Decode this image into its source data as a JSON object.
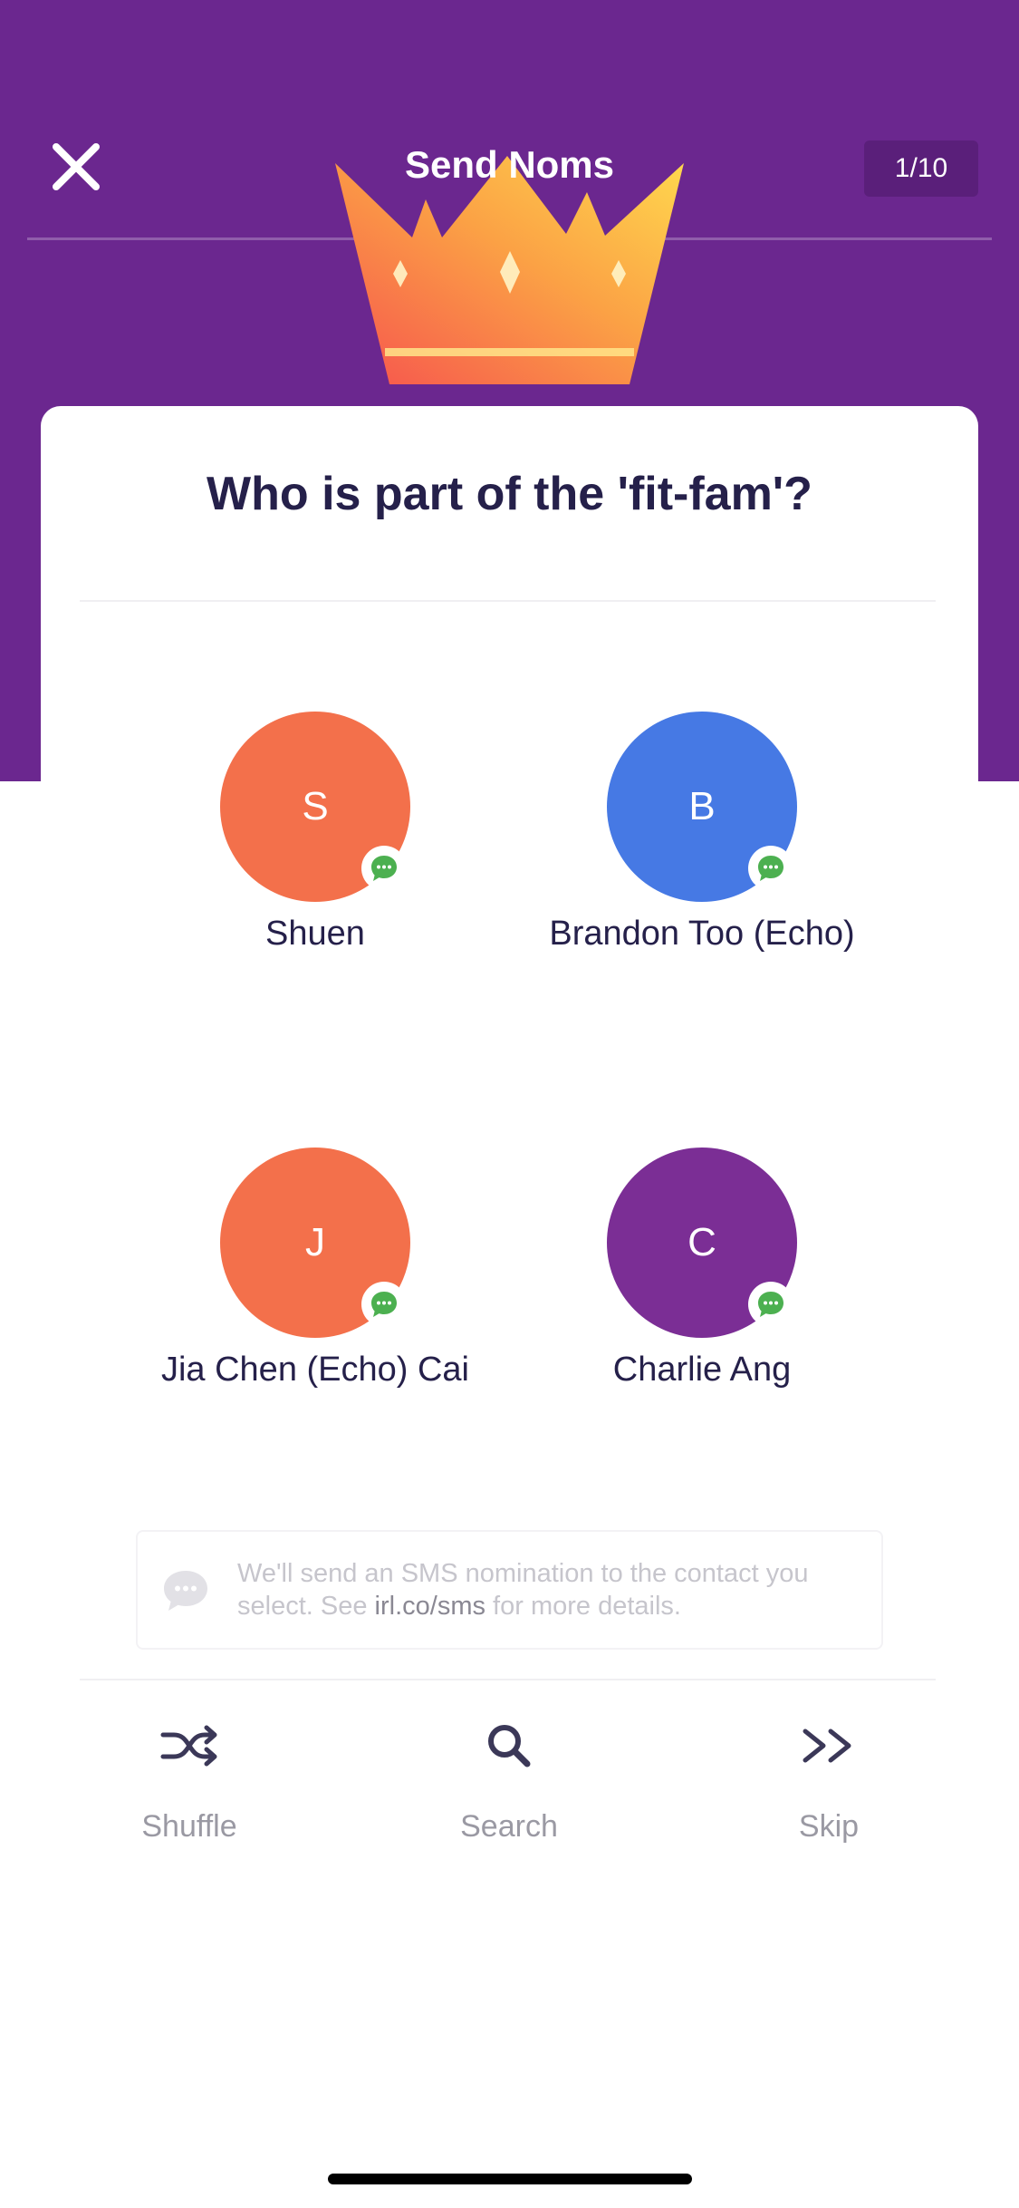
{
  "header": {
    "title": "Send Noms",
    "progress": "1/10"
  },
  "colors": {
    "header_bg": "#6B278F",
    "text_dark": "#25204A",
    "sms_green": "#4CB050"
  },
  "card": {
    "question": "Who is part of the 'fit-fam'?"
  },
  "contacts": [
    {
      "initial": "S",
      "name": "Shuen",
      "color": "#F3704B"
    },
    {
      "initial": "B",
      "name": "Brandon Too (Echo)",
      "color": "#4679E4"
    },
    {
      "initial": "J",
      "name": "Jia Chen (Echo) Cai",
      "color": "#F3704B"
    },
    {
      "initial": "C",
      "name": "Charlie Ang",
      "color": "#7B2E95"
    }
  ],
  "sms_note": {
    "text_before": "We'll send an SMS nomination to the contact you select. See ",
    "link": "irl.co/sms",
    "text_after": " for more details."
  },
  "actions": {
    "shuffle": {
      "label": "Shuffle",
      "icon": "shuffle-icon"
    },
    "search": {
      "label": "Search",
      "icon": "search-icon"
    },
    "skip": {
      "label": "Skip",
      "icon": "skip-icon"
    }
  }
}
